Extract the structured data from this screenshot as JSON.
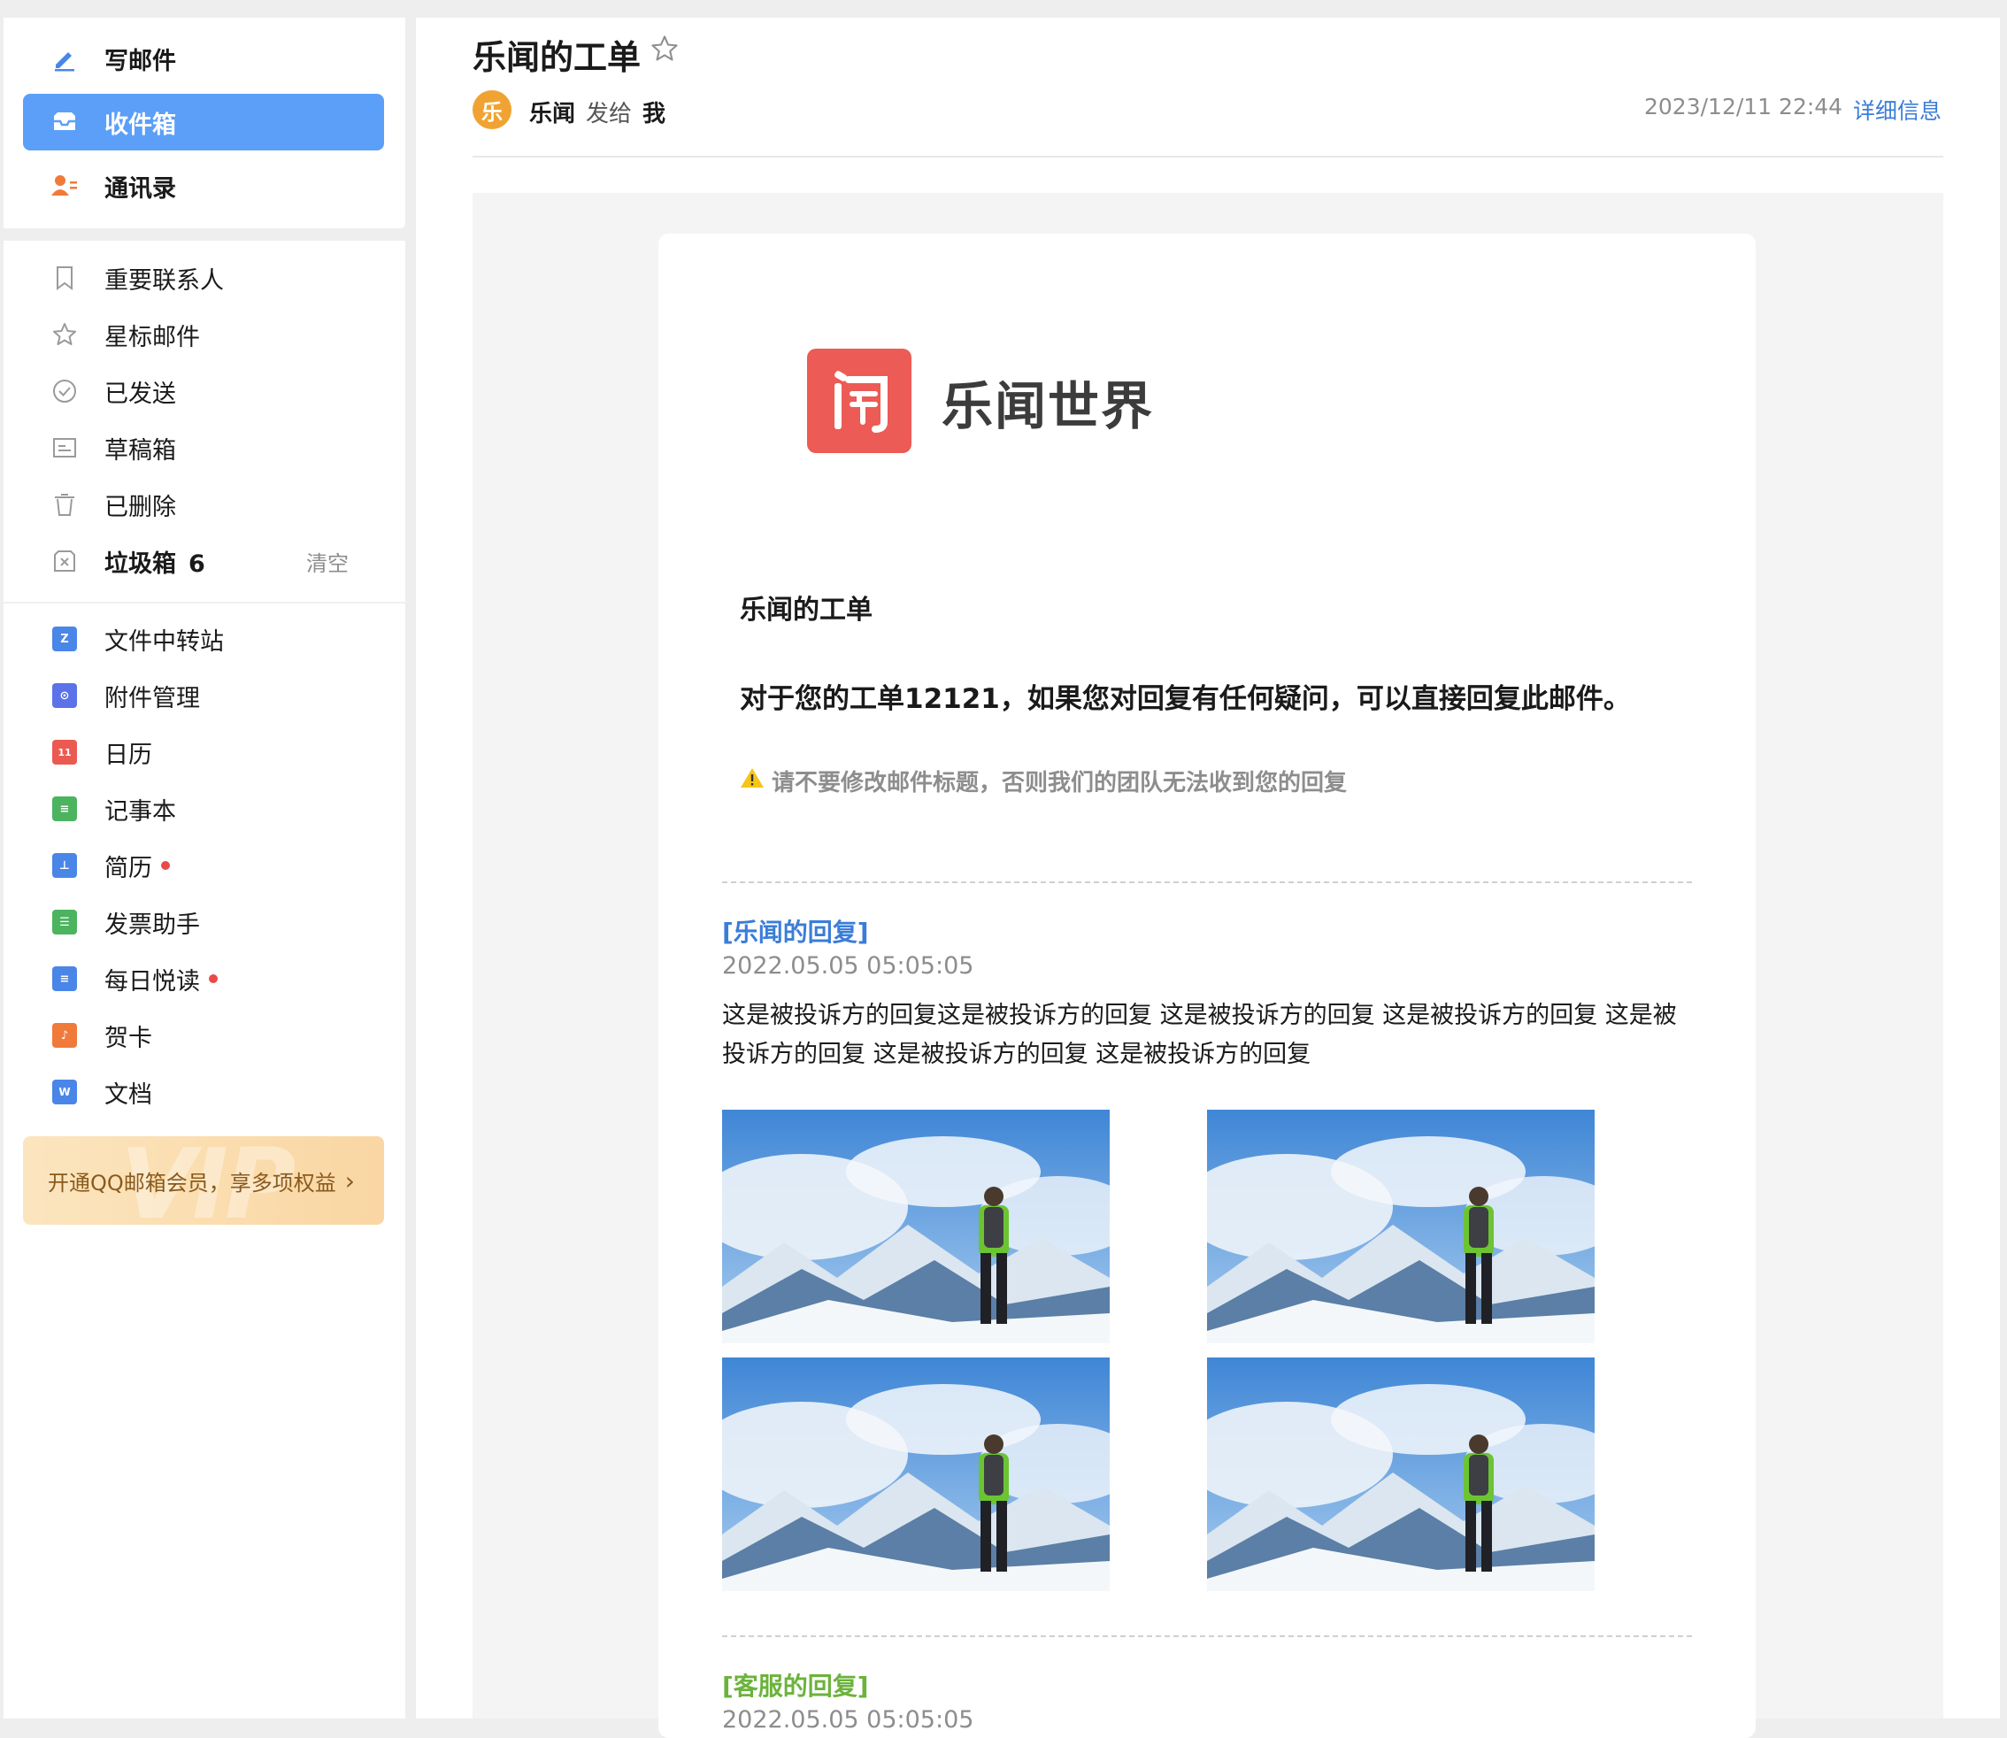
{
  "sidebar": {
    "primary": [
      {
        "label": "写邮件",
        "icon": "pencil-icon"
      },
      {
        "label": "收件箱",
        "icon": "inbox-icon"
      },
      {
        "label": "通讯录",
        "icon": "contacts-icon"
      }
    ],
    "folders": [
      {
        "label": "重要联系人",
        "icon": "bookmark-icon"
      },
      {
        "label": "星标邮件",
        "icon": "star-icon"
      },
      {
        "label": "已发送",
        "icon": "check-circle-icon"
      },
      {
        "label": "草稿箱",
        "icon": "draft-icon"
      },
      {
        "label": "已删除",
        "icon": "trash-icon"
      },
      {
        "label": "垃圾箱",
        "icon": "spam-icon",
        "count": "6",
        "action": "清空"
      }
    ],
    "apps": [
      {
        "label": "文件中转站",
        "icon": "file-transfer-icon",
        "color": "#4a86e8",
        "glyph": "Z"
      },
      {
        "label": "附件管理",
        "icon": "attachment-icon",
        "color": "#5b72e8",
        "glyph": "⊙"
      },
      {
        "label": "日历",
        "icon": "calendar-icon",
        "color": "#ea5a50",
        "glyph": "11"
      },
      {
        "label": "记事本",
        "icon": "notepad-icon",
        "color": "#4cb35f",
        "glyph": "≡"
      },
      {
        "label": "简历",
        "icon": "resume-icon",
        "color": "#4a86e8",
        "glyph": "⊥"
      },
      {
        "label": "发票助手",
        "icon": "invoice-icon",
        "color": "#4cb35f",
        "glyph": "☰"
      },
      {
        "label": "每日悦读",
        "icon": "daily-read-icon",
        "color": "#4a86e8",
        "glyph": "≡"
      },
      {
        "label": "贺卡",
        "icon": "greeting-card-icon",
        "color": "#f07a3a",
        "glyph": "♪"
      },
      {
        "label": "文档",
        "icon": "document-icon",
        "color": "#4a86e8",
        "glyph": "W"
      }
    ],
    "vip_text": "开通QQ邮箱会员，享多项权益",
    "vip_watermark": "VIP"
  },
  "mail": {
    "subject": "乐闻的工单",
    "sender_avatar": "乐",
    "sender": "乐闻",
    "to_word": "发给",
    "recipient": "我",
    "date": "2023/12/11 22:44",
    "detail_link": "详细信息",
    "brand_name": "乐闻世界",
    "brand_logo_glyph": "闻",
    "ticket_title": "乐闻的工单",
    "ticket_message": "对于您的工单12121，如果您对回复有任何疑问，可以直接回复此邮件。",
    "warning": "请不要修改邮件标题，否则我们的团队无法收到您的回复",
    "replies": [
      {
        "label": "[乐闻的回复]",
        "color": "#3a7dd8",
        "date": "2022.05.05 05:05:05",
        "text": "这是被投诉方的回复这是被投诉方的回复 这是被投诉方的回复 这是被投诉方的回复 这是被投诉方的回复 这是被投诉方的回复 这是被投诉方的回复"
      },
      {
        "label": "[客服的回复]",
        "color": "#6bb33c",
        "date": "2022.05.05 05:05:05"
      }
    ]
  }
}
